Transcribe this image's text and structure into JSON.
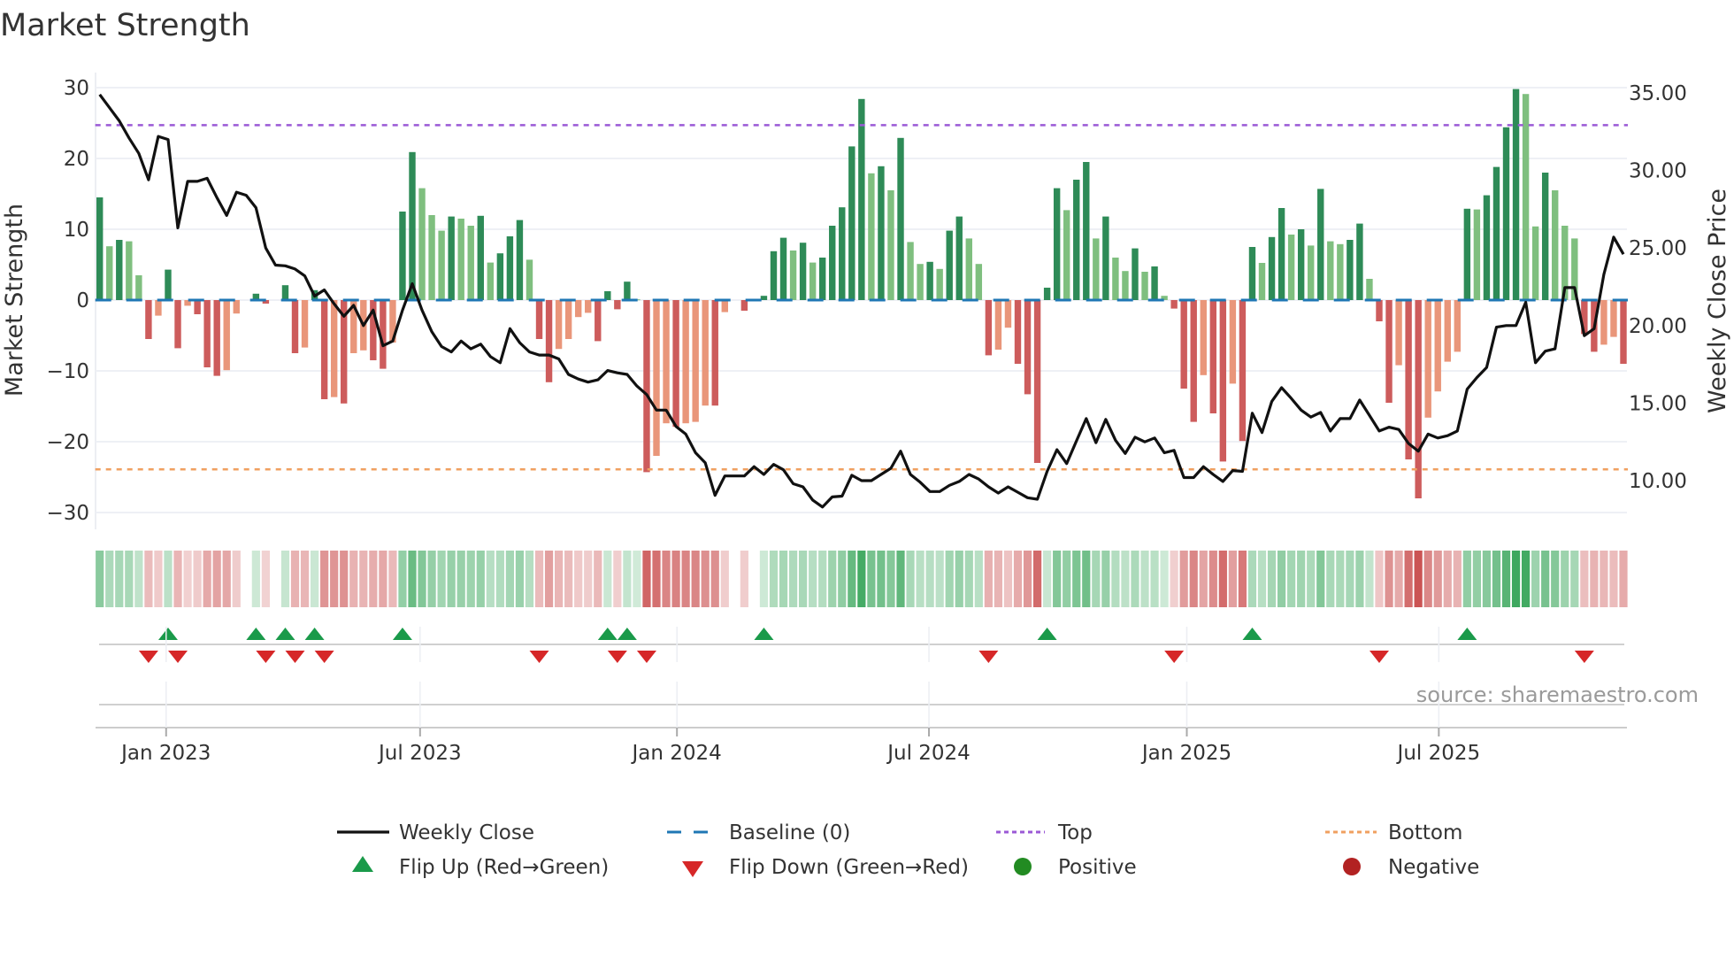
{
  "chart_data": {
    "type": "bar",
    "title": "Market Strength",
    "ylabel": "Market Strength",
    "ylabel_right": "Weekly Close Price",
    "ylim": [
      -30,
      30
    ],
    "ylim_right_ticks": [
      "10.00",
      "15.00",
      "20.00",
      "25.00",
      "30.00",
      "35.00"
    ],
    "yticks": [
      "−30",
      "−20",
      "−10",
      "0",
      "10",
      "20",
      "30"
    ],
    "top_level": 24.7,
    "bottom_level": -23.9,
    "x_ticks": [
      {
        "label": "Jan 2023",
        "week_index": 6.8
      },
      {
        "label": "Jul 2023",
        "week_index": 32.8
      },
      {
        "label": "Jan 2024",
        "week_index": 59.1
      },
      {
        "label": "Jul 2024",
        "week_index": 84.9
      },
      {
        "label": "Jan 2025",
        "week_index": 111.3
      },
      {
        "label": "Jul 2025",
        "week_index": 137.1
      }
    ],
    "strength": [
      14.5,
      7.6,
      8.5,
      8.3,
      3.5,
      -5.5,
      -2.2,
      4.3,
      -6.8,
      -0.8,
      -2,
      -9.5,
      -10.7,
      -9.9,
      -1.9,
      0,
      0.9,
      -0.5,
      0,
      2.1,
      -7.5,
      -6.7,
      1.4,
      -14,
      -13.7,
      -14.6,
      -7.5,
      -7.1,
      -8.5,
      -9.7,
      -6,
      12.5,
      20.9,
      15.8,
      12,
      9.8,
      11.8,
      11.5,
      10.5,
      11.9,
      5.3,
      6.6,
      9,
      11.3,
      5.7,
      -5.5,
      -11.6,
      -6.9,
      -5.5,
      -2.4,
      -1.8,
      -5.8,
      1.25,
      -1.3,
      2.6,
      0.1,
      -24.3,
      -22,
      -17.4,
      -17.9,
      -17.4,
      -17.2,
      -14.9,
      -14.9,
      -1.7,
      0,
      -1.5,
      0,
      0.6,
      6.9,
      8.8,
      7,
      8.1,
      5.3,
      6,
      10.5,
      13.1,
      21.7,
      28.4,
      17.9,
      18.9,
      15.5,
      22.9,
      8.2,
      5.1,
      5.4,
      4.4,
      9.8,
      11.8,
      8.7,
      5.1,
      -7.8,
      -7,
      -3.9,
      -9,
      -13.3,
      -23,
      1.75,
      15.8,
      12.7,
      17,
      19.5,
      8.7,
      11.8,
      6,
      4.1,
      7.3,
      4,
      4.75,
      0.6,
      -1.2,
      -12.5,
      -17.2,
      -10.6,
      -16,
      -22.8,
      -11.8,
      -19.9,
      7.5,
      5.25,
      8.9,
      13,
      9.25,
      10,
      7.7,
      15.7,
      8.3,
      7.9,
      8.5,
      10.8,
      3,
      -3,
      -14.5,
      -9.2,
      -22.5,
      -28,
      -16.6,
      -12.9,
      -8.7,
      -7.3,
      12.9,
      12.8,
      14.8,
      18.8,
      24.4,
      29.8,
      29.1,
      10.4,
      18,
      15.5,
      10.5,
      8.7,
      -4.8,
      -7.3,
      -6.3,
      -5.2,
      -9
    ],
    "weekly_close": [
      34.9,
      34.05,
      33.2,
      32.1,
      31.1,
      29.4,
      32.2,
      32,
      26.3,
      29.3,
      29.3,
      29.5,
      28.25,
      27.1,
      28.6,
      28.4,
      27.6,
      25,
      23.9,
      23.85,
      23.65,
      23.2,
      21.9,
      22.3,
      21.4,
      20.6,
      21.3,
      20,
      21,
      18.7,
      19,
      21,
      22.7,
      21,
      19.6,
      18.65,
      18.3,
      19,
      18.5,
      18.8,
      18,
      17.6,
      19.8,
      18.9,
      18.3,
      18.1,
      18.1,
      17.85,
      16.85,
      16.55,
      16.35,
      16.5,
      17.1,
      16.95,
      16.85,
      16.1,
      15.55,
      14.55,
      14.55,
      13.5,
      13,
      11.8,
      11.15,
      9.05,
      10.3,
      10.3,
      10.3,
      10.9,
      10.4,
      11.05,
      10.7,
      9.8,
      9.6,
      8.75,
      8.3,
      8.95,
      9,
      10.35,
      10,
      10,
      10.4,
      10.8,
      11.9,
      10.4,
      9.9,
      9.3,
      9.3,
      9.7,
      9.95,
      10.4,
      10.1,
      9.6,
      9.2,
      9.6,
      9.25,
      8.9,
      8.8,
      10.6,
      12,
      11.1,
      12.55,
      14,
      12.45,
      13.95,
      12.6,
      11.75,
      12.8,
      12.5,
      12.75,
      11.8,
      11.95,
      10.2,
      10.2,
      10.9,
      10.4,
      9.95,
      10.65,
      10.6,
      14.35,
      13.1,
      15.1,
      16,
      15.3,
      14.55,
      14.1,
      14.4,
      13.2,
      14,
      14,
      15.2,
      14.2,
      13.2,
      13.45,
      13.3,
      12.4,
      11.9,
      13,
      12.75,
      12.9,
      13.2,
      15.9,
      16.65,
      17.3,
      19.9,
      20,
      20,
      21.5,
      17.6,
      18.35,
      18.5,
      22.45,
      22.45,
      19.35,
      19.8,
      23.3,
      25.7,
      24.6
    ],
    "flip_up_weeks": [
      7,
      16,
      19,
      22,
      31,
      52,
      54,
      68,
      97,
      118,
      140
    ],
    "flip_down_weeks": [
      5,
      8,
      17,
      20,
      23,
      45,
      53,
      56,
      91,
      110,
      131,
      152
    ],
    "legend": {
      "weekly_close": "Weekly Close",
      "baseline": "Baseline (0)",
      "top": "Top",
      "bottom": "Bottom",
      "flip_up": "Flip Up (Red→Green)",
      "flip_down": "Flip Down (Green→Red)",
      "positive": "Positive",
      "negative": "Negative"
    },
    "source": "source: sharemaestro.com",
    "colors": {
      "pos_strong": "#2e8b57",
      "pos_weak": "#7fbf7f",
      "neg_strong": "#cd5c5c",
      "neg_weak": "#e9967a",
      "baseline": "#1f77b4",
      "top": "#9b59d6",
      "bottom": "#f0a060",
      "flip_up": "#1a9a4a",
      "flip_down": "#d62728",
      "positive": "#228b22",
      "negative": "#b22222"
    }
  }
}
